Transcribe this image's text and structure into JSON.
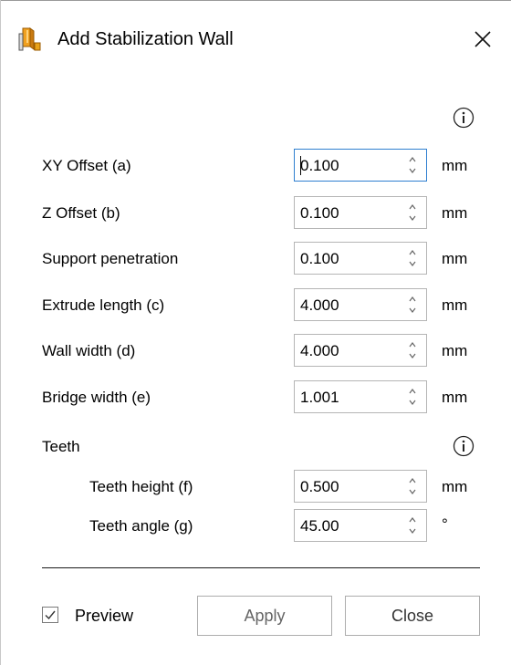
{
  "window": {
    "title": "Add Stabilization Wall"
  },
  "fields": [
    {
      "label": "XY Offset (a)",
      "value": "0.100",
      "unit": "mm"
    },
    {
      "label": "Z Offset (b)",
      "value": "0.100",
      "unit": "mm"
    },
    {
      "label": "Support penetration",
      "value": "0.100",
      "unit": "mm"
    },
    {
      "label": "Extrude length (c)",
      "value": "4.000",
      "unit": "mm"
    },
    {
      "label": "Wall width (d)",
      "value": "4.000",
      "unit": "mm"
    },
    {
      "label": "Bridge width (e)",
      "value": "1.001",
      "unit": "mm"
    }
  ],
  "teeth": {
    "section_label": "Teeth",
    "fields": [
      {
        "label": "Teeth height (f)",
        "value": "0.500",
        "unit": "mm"
      },
      {
        "label": "Teeth angle (g)",
        "value": "45.00",
        "unit": "°"
      }
    ]
  },
  "footer": {
    "preview_label": "Preview",
    "preview_checked": true,
    "apply_label": "Apply",
    "close_label": "Close"
  },
  "colors": {
    "focus_border": "#2f7fd0",
    "icon_orange": "#e8a21a"
  },
  "icons": {
    "app": "wall-support-icon",
    "close": "close-icon",
    "info": "info-icon",
    "spinner": "spinner-arrows-icon",
    "check": "checkmark-icon"
  }
}
